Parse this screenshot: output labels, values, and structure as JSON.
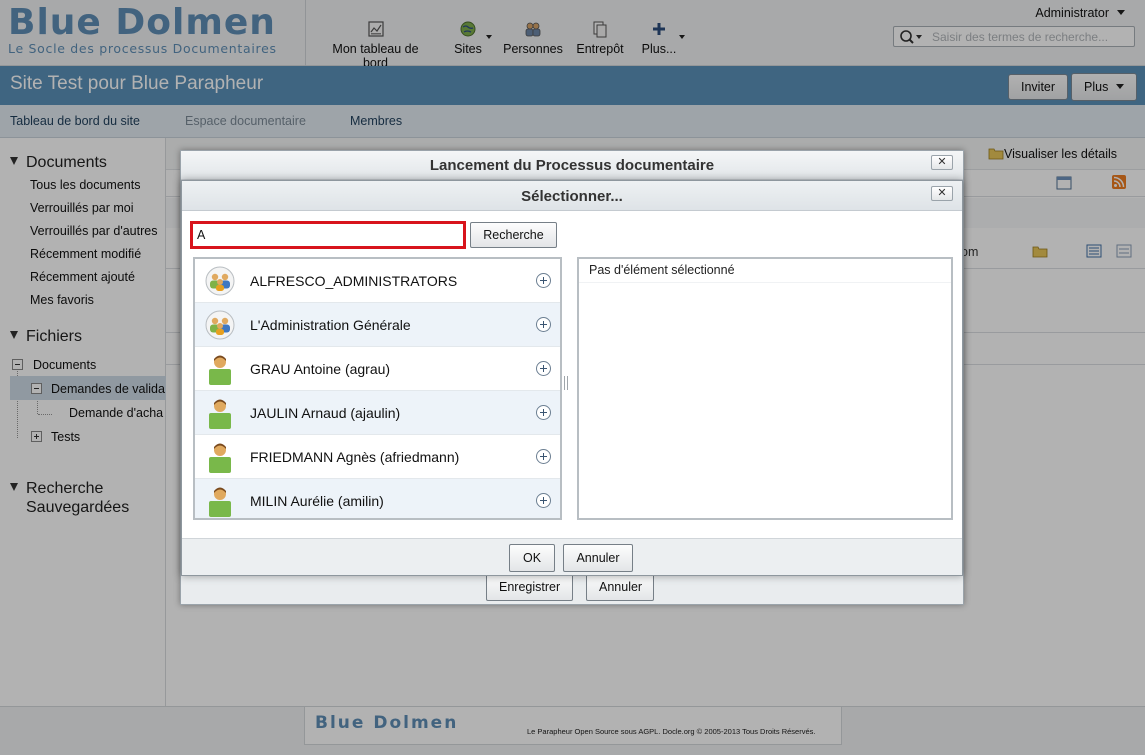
{
  "header": {
    "logo_title": "Blue Dolmen",
    "logo_subtitle": "Le Socle des processus Documentaires",
    "nav": [
      {
        "label": "Mon tableau de bord",
        "icon": "dashboard-icon"
      },
      {
        "label": "Sites",
        "icon": "globe-icon"
      },
      {
        "label": "Personnes",
        "icon": "people-icon"
      },
      {
        "label": "Entrepôt",
        "icon": "repository-icon"
      },
      {
        "label": "Plus...",
        "icon": "plus-icon"
      }
    ],
    "user": "Administrator",
    "search_placeholder": "Saisir des termes de recherche..."
  },
  "site": {
    "title": "Site Test pour Blue Parapheur",
    "invite_label": "Inviter",
    "more_label": "Plus",
    "nav": [
      "Tableau de bord du site",
      "Espace documentaire",
      "Membres"
    ]
  },
  "sidebar": {
    "documents_heading": "Documents",
    "document_links": [
      "Tous les documents",
      "Verrouillés par moi",
      "Verrouillés par d'autres",
      "Récemment modifié",
      "Récemment ajouté",
      "Mes favoris"
    ],
    "files_heading": "Fichiers",
    "tree": [
      "Documents",
      "Demandes de valida",
      "Demande d'acha",
      "Tests"
    ],
    "saved_search_heading_1": "Recherche",
    "saved_search_heading_2": "Sauvegardées"
  },
  "content": {
    "view_details": "Visualiser les détails",
    "sort_fragment": "om"
  },
  "outer_dialog": {
    "title": "Lancement du Processus documentaire",
    "close": "✕",
    "save_label": "Enregistrer",
    "cancel_label": "Annuler"
  },
  "picker": {
    "title": "Sélectionner...",
    "close": "✕",
    "search_value": "A",
    "search_button": "Recherche",
    "results": [
      {
        "name": "ALFRESCO_ADMINISTRATORS",
        "type": "group"
      },
      {
        "name": "L'Administration Générale",
        "type": "group"
      },
      {
        "name": "GRAU Antoine (agrau)",
        "type": "user"
      },
      {
        "name": "JAULIN Arnaud (ajaulin)",
        "type": "user"
      },
      {
        "name": "FRIEDMANN Agnès (afriedmann)",
        "type": "user"
      },
      {
        "name": "MILIN Aurélie (amilin)",
        "type": "user"
      }
    ],
    "empty_selection": "Pas d'élément sélectionné",
    "ok_label": "OK",
    "cancel_label": "Annuler"
  },
  "footer": {
    "logo": "Blue Dolmen",
    "text": "Le Parapheur Open Source sous AGPL. Docle.org © 2005-2013 Tous Droits Réservés."
  },
  "colors": {
    "site_bar": "#5b91b9",
    "highlight": "#d8141c",
    "logo": "#5f8fb6"
  }
}
